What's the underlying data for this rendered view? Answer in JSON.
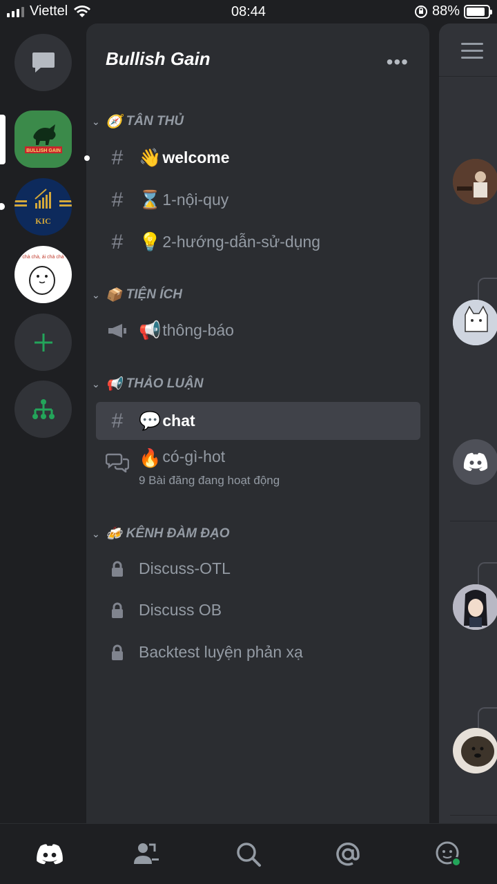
{
  "status_bar": {
    "carrier": "Viettel",
    "time": "08:44",
    "battery": "88%",
    "battery_level": 0.88
  },
  "server": {
    "name": "Bullish Gain",
    "more_icon": "ellipsis-icon"
  },
  "servers": [
    {
      "name": "direct-messages",
      "icon": "chat-bubble-icon"
    },
    {
      "name": "Bullish Gain",
      "logo_text": "BULLISH GAIN"
    },
    {
      "name": "KIC",
      "logo_text": "KIC"
    },
    {
      "name": "chá chà",
      "logo_text": "chà chà, ái chà chà"
    },
    {
      "name": "add-server",
      "icon": "plus-icon"
    },
    {
      "name": "explore",
      "icon": "hub-icon"
    }
  ],
  "categories": {
    "tan_thu": {
      "emoji": "🧭",
      "label": "TÂN THỦ"
    },
    "tien_ich": {
      "emoji": "📦",
      "label": "TIỆN ÍCH"
    },
    "thao_luan": {
      "emoji": "📢",
      "label": "THẢO LUẬN"
    },
    "kenh_dam_dao": {
      "emoji": "🍻",
      "label": "KÊNH ĐÀM ĐẠO"
    }
  },
  "channels": {
    "welcome": {
      "emoji": "👋",
      "name": "welcome"
    },
    "noi_quy": {
      "emoji": "⌛",
      "name": "1-nội-quy"
    },
    "huong_dan": {
      "emoji": "💡",
      "name": "2-hướng-dẫn-sử-dụng"
    },
    "thong_bao": {
      "emoji": "📢",
      "name": "thông-báo"
    },
    "chat": {
      "emoji": "💬",
      "name": "chat"
    },
    "co_gi_hot": {
      "emoji": "🔥",
      "name": "có-gì-hot",
      "sub": "9 Bài đăng đang hoạt động"
    },
    "discuss_otl": {
      "name": "Discuss-OTL"
    },
    "discuss_ob": {
      "name": "Discuss OB"
    },
    "backtest": {
      "name": "Backtest luyện phản xạ"
    }
  },
  "colors": {
    "accent": "#23a55a",
    "background": "#1e1f22",
    "panel": "#2b2d31",
    "selected": "#404249"
  }
}
